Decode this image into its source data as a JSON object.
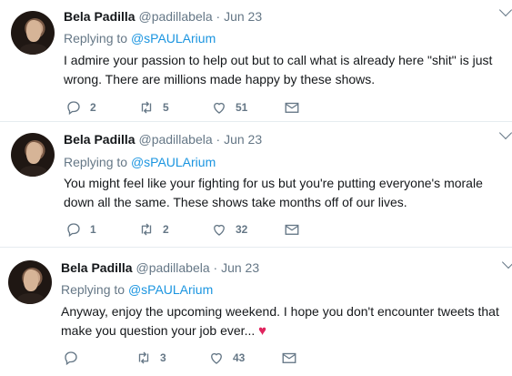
{
  "tweets": [
    {
      "name": "Bela Padilla",
      "handle": "@padillabela",
      "separator": "·",
      "date": "Jun 23",
      "replying_label": "Replying to",
      "mention": "@sPAULArium",
      "lines": [
        "I admire your passion to help out but to call what is already here \"shit\" is just",
        "wrong. There are millions made happy by these shows."
      ],
      "replies": "2",
      "retweets": "5",
      "likes": "51"
    },
    {
      "name": "Bela Padilla",
      "handle": "@padillabela",
      "separator": "·",
      "date": "Jun 23",
      "replying_label": "Replying to",
      "mention": "@sPAULArium",
      "lines": [
        "You might feel like your fighting for us but you're putting everyone's morale",
        "down all the same. These shows take months off of our lives."
      ],
      "replies": "1",
      "retweets": "2",
      "likes": "32"
    },
    {
      "name": "Bela Padilla",
      "handle": "@padillabela",
      "separator": "·",
      "date": "Jun 23",
      "replying_label": "Replying to",
      "mention": "@sPAULArium",
      "lines": [
        "Anyway, enjoy the upcoming weekend. I hope you don't encounter tweets that",
        "make you question your job ever..."
      ],
      "emoji": "♥",
      "replies": "",
      "retweets": "3",
      "likes": "43"
    }
  ],
  "icons": {
    "reply": "reply-icon",
    "retweet": "retweet-icon",
    "like": "heart-icon",
    "dm": "envelope-icon",
    "caret": "chevron-down-icon"
  },
  "colors": {
    "link": "#1b95e0",
    "secondary_text": "#657786",
    "divider": "#e6ecf0",
    "emoji_heart": "#e0245e"
  }
}
